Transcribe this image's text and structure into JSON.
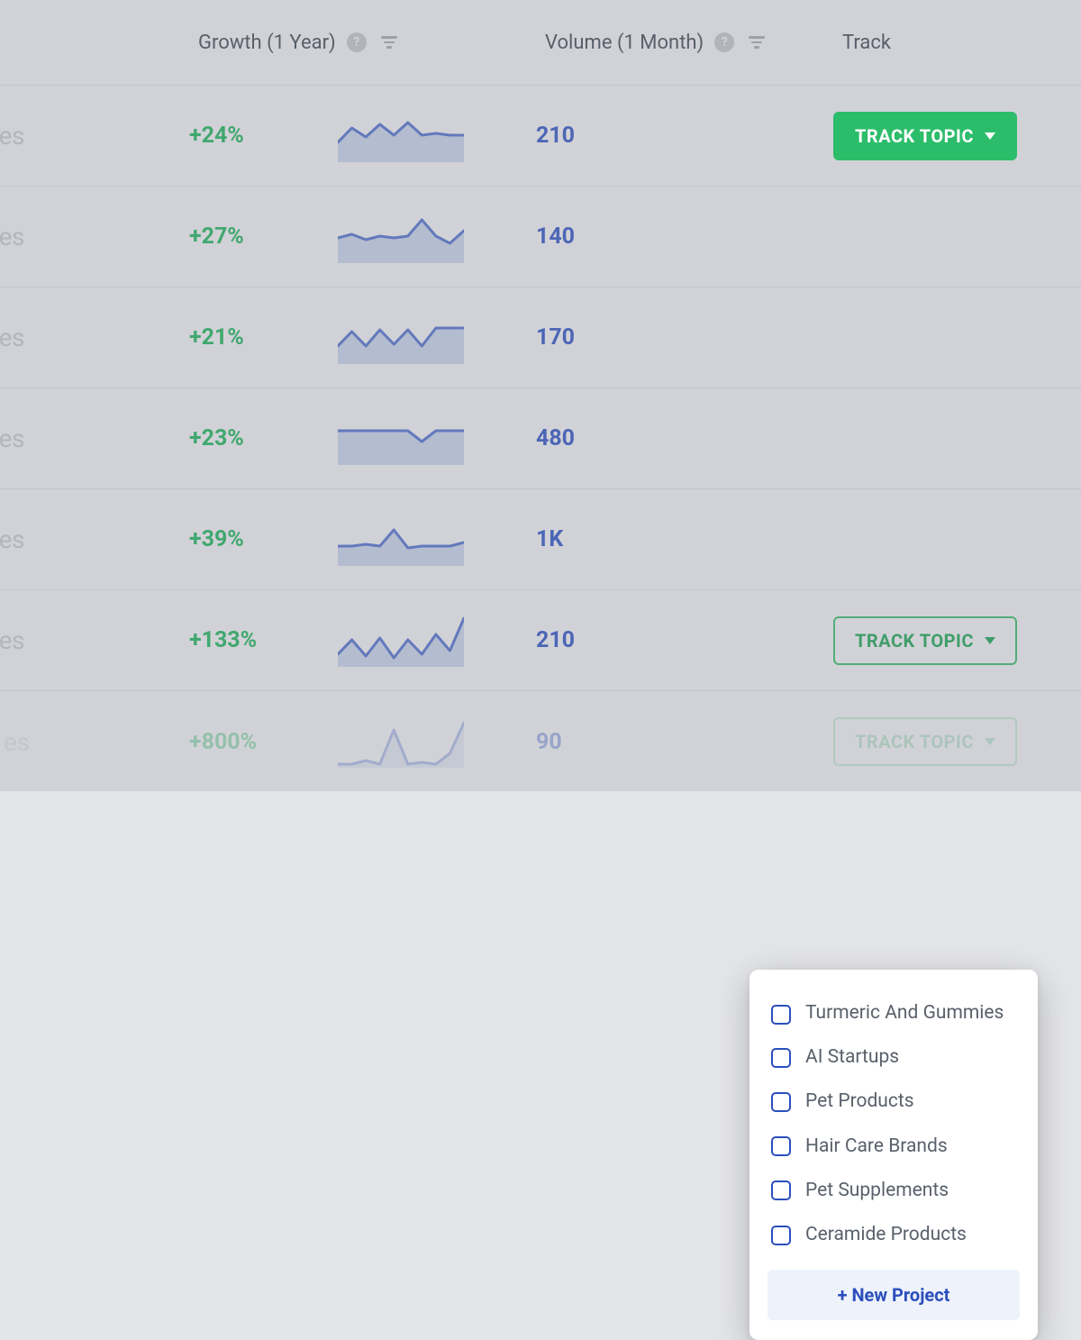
{
  "headers": {
    "growth": "Growth (1 Year)",
    "volume": "Volume (1 Month)",
    "track": "Track"
  },
  "row_label_partial": "tes",
  "row_label_partial_last": "es",
  "track_button_label": "TRACK TOPIC",
  "rows": [
    {
      "growth": "+24%",
      "volume": "210",
      "button_style": "filled"
    },
    {
      "growth": "+27%",
      "volume": "140",
      "button_style": "outline"
    },
    {
      "growth": "+21%",
      "volume": "170",
      "button_style": "outline"
    },
    {
      "growth": "+23%",
      "volume": "480",
      "button_style": "outline"
    },
    {
      "growth": "+39%",
      "volume": "1K",
      "button_style": "outline"
    },
    {
      "growth": "+133%",
      "volume": "210",
      "button_style": "outline"
    },
    {
      "growth": "+800%",
      "volume": "90",
      "button_style": "outline"
    }
  ],
  "dropdown": {
    "options": [
      "Turmeric And Gummies",
      "AI Startups",
      "Pet Products",
      "Hair Care Brands",
      "Pet Supplements",
      "Ceramide Products"
    ],
    "new_project_label": "+ New Project"
  },
  "colors": {
    "growth_green": "#1cab59",
    "volume_blue": "#2b4fbc",
    "button_green": "#2cbd6b",
    "spark_line": "#4b6ac4",
    "spark_fill": "#b0bedd"
  },
  "sparklines": [
    [
      38,
      22,
      32,
      18,
      30,
      16,
      30,
      28,
      30,
      30
    ],
    [
      32,
      28,
      34,
      30,
      32,
      30,
      12,
      30,
      38,
      24
    ],
    [
      40,
      24,
      40,
      22,
      38,
      22,
      40,
      20,
      20,
      20
    ],
    [
      22,
      22,
      22,
      22,
      22,
      22,
      34,
      22,
      22,
      22
    ],
    [
      38,
      38,
      36,
      38,
      20,
      40,
      38,
      38,
      38,
      34
    ],
    [
      46,
      30,
      48,
      28,
      50,
      30,
      46,
      24,
      42,
      6
    ],
    [
      56,
      56,
      52,
      56,
      18,
      56,
      54,
      56,
      44,
      10
    ]
  ]
}
